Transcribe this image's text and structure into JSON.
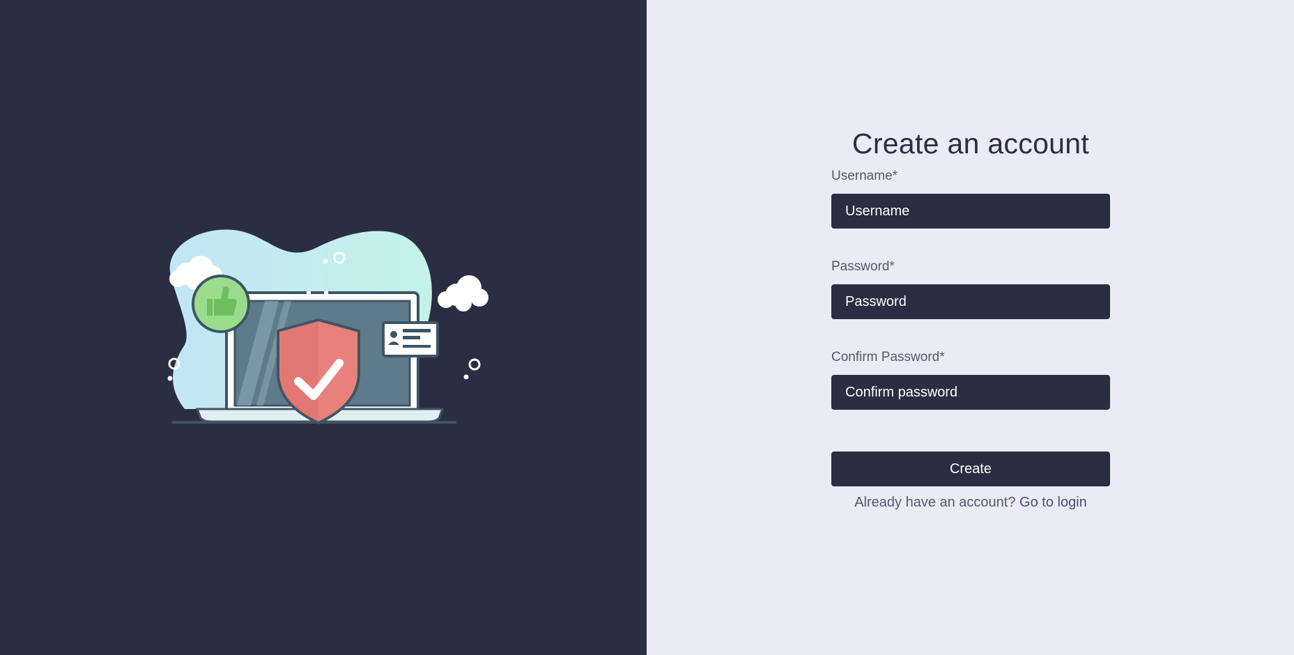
{
  "illustration": {
    "description_icon": "security-laptop-illustration"
  },
  "form": {
    "title": "Create an account",
    "username": {
      "label": "Username*",
      "placeholder": "Username",
      "value": ""
    },
    "password": {
      "label": "Password*",
      "placeholder": "Password",
      "value": ""
    },
    "confirm_password": {
      "label": "Confirm Password*",
      "placeholder": "Confirm password",
      "value": ""
    },
    "submit_label": "Create",
    "footer_prompt": "Already have an account?",
    "login_link_label": "Go to login"
  },
  "colors": {
    "left_bg": "#2b2d42",
    "right_bg": "#ebebf5",
    "input_bg": "#2b2d42",
    "shield": "#e8817c",
    "thumbs_circle": "#9bdc8c",
    "blob_light": "#c5ecf3"
  }
}
